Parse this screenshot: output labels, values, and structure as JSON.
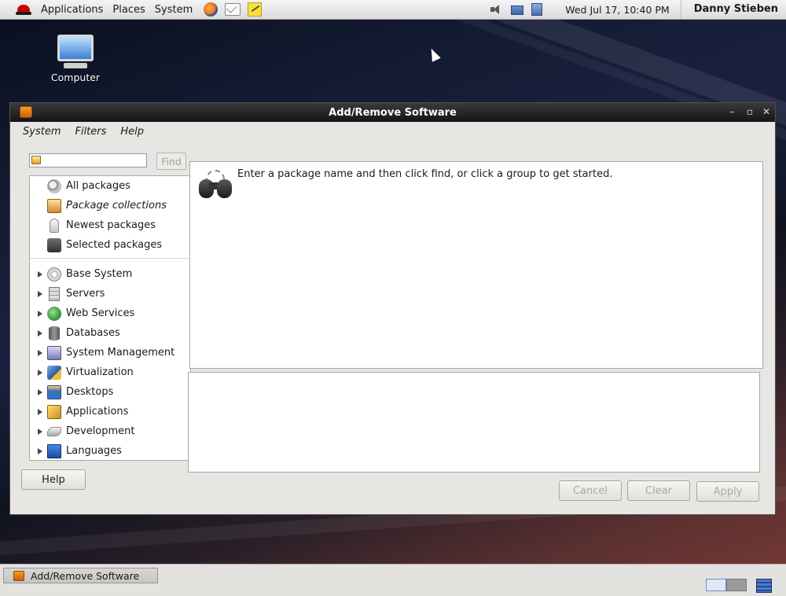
{
  "top_panel": {
    "menus": [
      "Applications",
      "Places",
      "System"
    ],
    "clock": "Wed Jul 17, 10:40 PM",
    "user": "Danny Stieben"
  },
  "desktop": {
    "icons": [
      {
        "label": "Computer",
        "icon": "computer-icon"
      }
    ]
  },
  "window": {
    "title": "Add/Remove Software",
    "menu": [
      "System",
      "Filters",
      "Help"
    ],
    "search": {
      "value": "",
      "placeholder": "",
      "find_label": "Find"
    },
    "groups_top": [
      {
        "label": "All packages",
        "icon": "all-packages-icon"
      },
      {
        "label": "Package collections",
        "icon": "package-collections-icon"
      },
      {
        "label": "Newest packages",
        "icon": "newest-packages-icon"
      },
      {
        "label": "Selected packages",
        "icon": "selected-packages-icon"
      }
    ],
    "groups": [
      {
        "label": "Base System",
        "icon": "base-system-icon"
      },
      {
        "label": "Servers",
        "icon": "servers-icon"
      },
      {
        "label": "Web Services",
        "icon": "web-services-icon"
      },
      {
        "label": "Databases",
        "icon": "databases-icon"
      },
      {
        "label": "System Management",
        "icon": "system-management-icon"
      },
      {
        "label": "Virtualization",
        "icon": "virtualization-icon"
      },
      {
        "label": "Desktops",
        "icon": "desktops-icon"
      },
      {
        "label": "Applications",
        "icon": "applications-icon"
      },
      {
        "label": "Development",
        "icon": "development-icon"
      },
      {
        "label": "Languages",
        "icon": "languages-icon"
      }
    ],
    "info_text": "Enter a package name and then click find, or click a group to get started.",
    "buttons": {
      "help": "Help",
      "cancel": "Cancel",
      "clear": "Clear",
      "apply": "Apply"
    }
  },
  "taskbar": {
    "items": [
      {
        "label": "Add/Remove Software"
      }
    ]
  }
}
